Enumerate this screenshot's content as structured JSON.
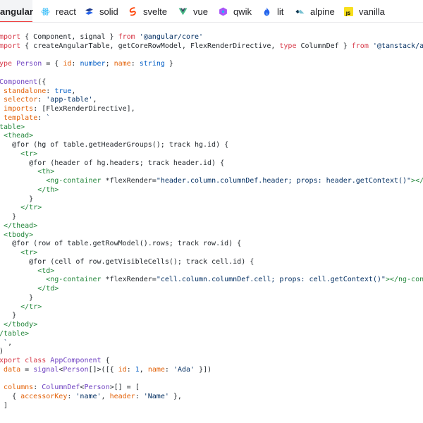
{
  "tabs": [
    {
      "label": "angular",
      "icon": "angular-icon",
      "active": true
    },
    {
      "label": "react",
      "icon": "react-icon",
      "active": false
    },
    {
      "label": "solid",
      "icon": "solid-icon",
      "active": false
    },
    {
      "label": "svelte",
      "icon": "svelte-icon",
      "active": false
    },
    {
      "label": "vue",
      "icon": "vue-icon",
      "active": false
    },
    {
      "label": "qwik",
      "icon": "qwik-icon",
      "active": false
    },
    {
      "label": "lit",
      "icon": "lit-icon",
      "active": false
    },
    {
      "label": "alpine",
      "icon": "alpine-icon",
      "active": false
    },
    {
      "label": "vanilla",
      "icon": "vanilla-icon",
      "active": false
    }
  ],
  "colors": {
    "accent": "#ef4444",
    "keyword": "#d73a49",
    "string": "#032f62",
    "type": "#6f42c1",
    "number": "#005cc5",
    "tag": "#22863a",
    "property": "#e36209"
  },
  "code_lines": [
    [
      [
        "kw",
        "import"
      ],
      [
        "pl",
        " { Component, signal } "
      ],
      [
        "kw",
        "from"
      ],
      [
        "pl",
        " "
      ],
      [
        "str",
        "'@angular/core'"
      ]
    ],
    [
      [
        "kw",
        "import"
      ],
      [
        "pl",
        " { createAngularTable, getCoreRowModel, FlexRenderDirective, "
      ],
      [
        "kw",
        "type"
      ],
      [
        "pl",
        " ColumnDef } "
      ],
      [
        "kw",
        "from"
      ],
      [
        "pl",
        " "
      ],
      [
        "str",
        "'@tanstack/angular-table'"
      ]
    ],
    [],
    [
      [
        "kw",
        "type"
      ],
      [
        "pl",
        " "
      ],
      [
        "ty",
        "Person"
      ],
      [
        "pl",
        " = { "
      ],
      [
        "pr",
        "id"
      ],
      [
        "pl",
        ": "
      ],
      [
        "num",
        "number"
      ],
      [
        "pl",
        "; "
      ],
      [
        "pr",
        "name"
      ],
      [
        "pl",
        ": "
      ],
      [
        "num",
        "string"
      ],
      [
        "pl",
        " }"
      ]
    ],
    [],
    [
      [
        "fn",
        "@Component"
      ],
      [
        "pl",
        "({"
      ]
    ],
    [
      [
        "pl",
        "  "
      ],
      [
        "pr",
        "standalone"
      ],
      [
        "pl",
        ": "
      ],
      [
        "num",
        "true"
      ],
      [
        "pl",
        ","
      ]
    ],
    [
      [
        "pl",
        "  "
      ],
      [
        "pr",
        "selector"
      ],
      [
        "pl",
        ": "
      ],
      [
        "str",
        "'app-table'"
      ],
      [
        "pl",
        ","
      ]
    ],
    [
      [
        "pl",
        "  "
      ],
      [
        "pr",
        "imports"
      ],
      [
        "pl",
        ": [FlexRenderDirective],"
      ]
    ],
    [
      [
        "pl",
        "  "
      ],
      [
        "pr",
        "template"
      ],
      [
        "pl",
        ": "
      ],
      [
        "str",
        "`"
      ]
    ],
    [
      [
        "tag",
        "<table>"
      ]
    ],
    [
      [
        "pl",
        "  "
      ],
      [
        "tag",
        "<thead>"
      ]
    ],
    [
      [
        "pl",
        "    @for (hg of table.getHeaderGroups(); track hg.id) {"
      ]
    ],
    [
      [
        "pl",
        "      "
      ],
      [
        "tag",
        "<tr>"
      ]
    ],
    [
      [
        "pl",
        "        @for (header of hg.headers; track header.id) {"
      ]
    ],
    [
      [
        "pl",
        "          "
      ],
      [
        "tag",
        "<th>"
      ]
    ],
    [
      [
        "pl",
        "            "
      ],
      [
        "tag",
        "<ng-container"
      ],
      [
        "pl",
        " *flexRender="
      ],
      [
        "str",
        "\"header.column.columnDef.header; props: header.getContext()\""
      ],
      [
        "tag",
        "></ng-container>"
      ]
    ],
    [
      [
        "pl",
        "          "
      ],
      [
        "tag",
        "</th>"
      ]
    ],
    [
      [
        "pl",
        "        }"
      ]
    ],
    [
      [
        "pl",
        "      "
      ],
      [
        "tag",
        "</tr>"
      ]
    ],
    [
      [
        "pl",
        "    }"
      ]
    ],
    [
      [
        "pl",
        "  "
      ],
      [
        "tag",
        "</thead>"
      ]
    ],
    [
      [
        "pl",
        "  "
      ],
      [
        "tag",
        "<tbody>"
      ]
    ],
    [
      [
        "pl",
        "    @for (row of table.getRowModel().rows; track row.id) {"
      ]
    ],
    [
      [
        "pl",
        "      "
      ],
      [
        "tag",
        "<tr>"
      ]
    ],
    [
      [
        "pl",
        "        @for (cell of row.getVisibleCells(); track cell.id) {"
      ]
    ],
    [
      [
        "pl",
        "          "
      ],
      [
        "tag",
        "<td>"
      ]
    ],
    [
      [
        "pl",
        "            "
      ],
      [
        "tag",
        "<ng-container"
      ],
      [
        "pl",
        " *flexRender="
      ],
      [
        "str",
        "\"cell.column.columnDef.cell; props: cell.getContext()\""
      ],
      [
        "tag",
        "></ng-container>"
      ]
    ],
    [
      [
        "pl",
        "          "
      ],
      [
        "tag",
        "</td>"
      ]
    ],
    [
      [
        "pl",
        "        }"
      ]
    ],
    [
      [
        "pl",
        "      "
      ],
      [
        "tag",
        "</tr>"
      ]
    ],
    [
      [
        "pl",
        "    }"
      ]
    ],
    [
      [
        "pl",
        "  "
      ],
      [
        "tag",
        "</tbody>"
      ]
    ],
    [
      [
        "tag",
        "</table>"
      ]
    ],
    [
      [
        "pl",
        "  "
      ],
      [
        "str",
        "`"
      ],
      [
        "pl",
        ","
      ]
    ],
    [
      [
        "pl",
        "})"
      ]
    ],
    [
      [
        "kw",
        "export"
      ],
      [
        "pl",
        " "
      ],
      [
        "kw",
        "class"
      ],
      [
        "pl",
        " "
      ],
      [
        "ty",
        "AppComponent"
      ],
      [
        "pl",
        " {"
      ]
    ],
    [
      [
        "pl",
        "  "
      ],
      [
        "pr",
        "data"
      ],
      [
        "pl",
        " = "
      ],
      [
        "fn",
        "signal"
      ],
      [
        "pl",
        "<"
      ],
      [
        "ty",
        "Person"
      ],
      [
        "pl",
        "[]>([{ "
      ],
      [
        "pr",
        "id"
      ],
      [
        "pl",
        ": "
      ],
      [
        "num",
        "1"
      ],
      [
        "pl",
        ", "
      ],
      [
        "pr",
        "name"
      ],
      [
        "pl",
        ": "
      ],
      [
        "str",
        "'Ada'"
      ],
      [
        "pl",
        " }])"
      ]
    ],
    [],
    [
      [
        "pl",
        "  "
      ],
      [
        "pr",
        "columns"
      ],
      [
        "pl",
        ": "
      ],
      [
        "ty",
        "ColumnDef"
      ],
      [
        "pl",
        "<"
      ],
      [
        "ty",
        "Person"
      ],
      [
        "pl",
        ">[] = ["
      ]
    ],
    [
      [
        "pl",
        "    { "
      ],
      [
        "pr",
        "accessorKey"
      ],
      [
        "pl",
        ": "
      ],
      [
        "str",
        "'name'"
      ],
      [
        "pl",
        ", "
      ],
      [
        "pr",
        "header"
      ],
      [
        "pl",
        ": "
      ],
      [
        "str",
        "'Name'"
      ],
      [
        "pl",
        " },"
      ]
    ],
    [
      [
        "pl",
        "  ]"
      ]
    ]
  ]
}
